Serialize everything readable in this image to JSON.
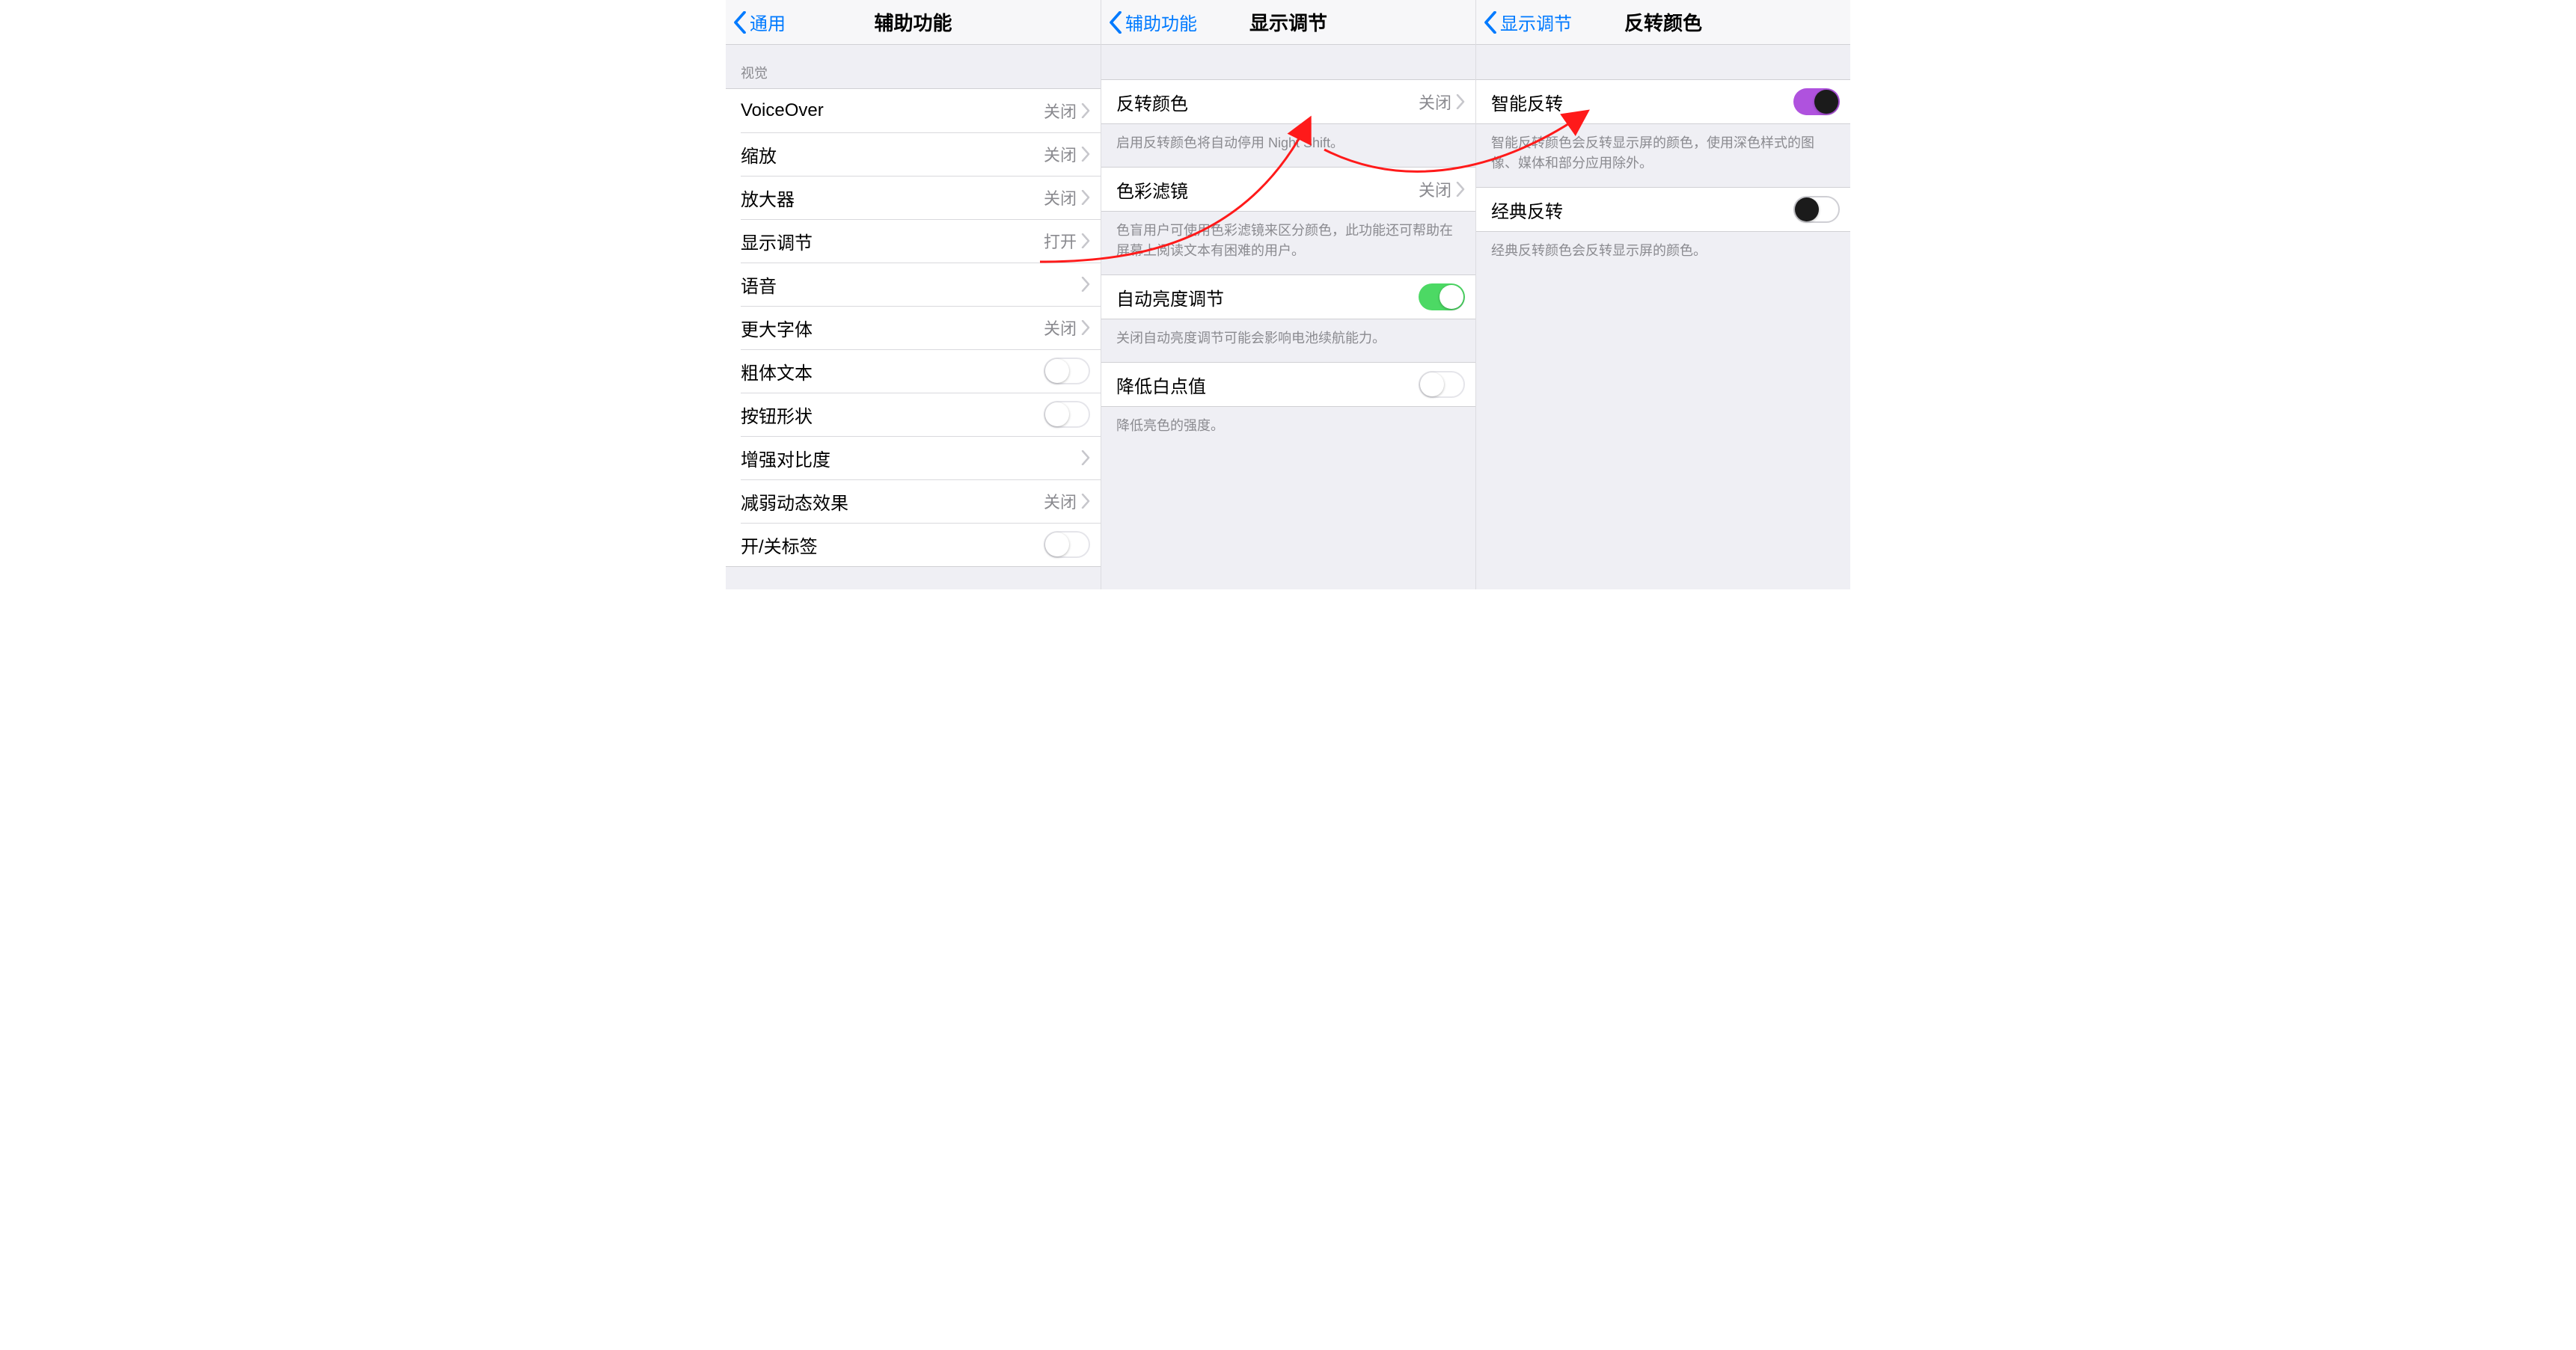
{
  "pane1": {
    "back_label": "通用",
    "title": "辅助功能",
    "group_label": "视觉",
    "rows": {
      "voiceover": {
        "label": "VoiceOver",
        "value": "关闭"
      },
      "zoom": {
        "label": "缩放",
        "value": "关闭"
      },
      "magnifier": {
        "label": "放大器",
        "value": "关闭"
      },
      "display": {
        "label": "显示调节",
        "value": "打开"
      },
      "speech": {
        "label": "语音",
        "value": ""
      },
      "larger": {
        "label": "更大字体",
        "value": "关闭"
      },
      "bold": {
        "label": "粗体文本"
      },
      "shapes": {
        "label": "按钮形状"
      },
      "contrast": {
        "label": "增强对比度"
      },
      "motion": {
        "label": "减弱动态效果",
        "value": "关闭"
      },
      "onoff": {
        "label": "开/关标签"
      }
    }
  },
  "pane2": {
    "back_label": "辅助功能",
    "title": "显示调节",
    "rows": {
      "invert": {
        "label": "反转颜色",
        "value": "关闭"
      },
      "filters": {
        "label": "色彩滤镜",
        "value": "关闭"
      },
      "autobright": {
        "label": "自动亮度调节"
      },
      "whitepoint": {
        "label": "降低白点值"
      }
    },
    "footers": {
      "invert": "启用反转颜色将自动停用 Night Shift。",
      "filters": "色盲用户可使用色彩滤镜来区分颜色，此功能还可帮助在屏幕上阅读文本有困难的用户。",
      "autobright": "关闭自动亮度调节可能会影响电池续航能力。",
      "whitepoint": "降低亮色的强度。"
    }
  },
  "pane3": {
    "back_label": "显示调节",
    "title": "反转颜色",
    "rows": {
      "smart": {
        "label": "智能反转"
      },
      "classic": {
        "label": "经典反转"
      }
    },
    "footers": {
      "smart": "智能反转颜色会反转显示屏的颜色，使用深色样式的图像、媒体和部分应用除外。",
      "classic": "经典反转颜色会反转显示屏的颜色。"
    }
  }
}
